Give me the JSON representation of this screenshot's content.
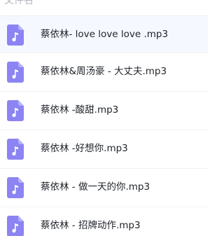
{
  "header": {
    "label": "文件名"
  },
  "files": [
    {
      "name": "蔡依林- love love love .mp3",
      "icon": "audio-file-icon",
      "selected": true
    },
    {
      "name": "蔡依林&周汤豪 - 大丈夫.mp3",
      "icon": "audio-file-icon",
      "selected": false
    },
    {
      "name": "蔡依林 -酸甜.mp3",
      "icon": "audio-file-icon",
      "selected": false
    },
    {
      "name": "蔡依林 -好想你.mp3",
      "icon": "audio-file-icon",
      "selected": false
    },
    {
      "name": "蔡依林 - 做一天的你.mp3",
      "icon": "audio-file-icon",
      "selected": false
    },
    {
      "name": "蔡依林 - 招牌动作.mp3",
      "icon": "audio-file-icon",
      "selected": false
    }
  ],
  "colors": {
    "icon_fill": "#8c84f2",
    "icon_note": "#ffffff",
    "selected_row": "#f5f9ff",
    "text": "#1f2329",
    "header_text": "#b3b6bd"
  }
}
